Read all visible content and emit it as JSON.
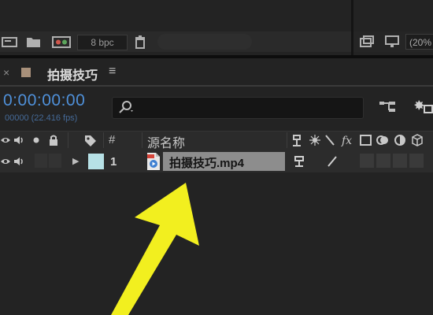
{
  "project_panel": {
    "bpc_label": "8 bpc",
    "zoom_value": "(20%"
  },
  "composition_tab": {
    "close_glyph": "×",
    "title": "拍摄技巧",
    "menu_glyph": "≡"
  },
  "timeline": {
    "timecode": "0:00:00:00",
    "frame_info": "00000 (22.416 fps)",
    "column_headers": {
      "number": "#",
      "source_name": "源名称"
    },
    "layer": {
      "index": "1",
      "name": "拍摄技巧.mp4",
      "label_color": "#b7e1e6"
    }
  },
  "annotation": {
    "arrow_color": "#f2ef1f"
  },
  "colors": {
    "timecode_blue": "#4f90d9",
    "panel_bg": "#232323"
  },
  "icons": [
    "comp-icon",
    "folder-icon",
    "color-settings-icon",
    "trash-icon",
    "snapshot-icon",
    "monitor-icon",
    "search-icon",
    "flowchart-icon",
    "render-icon",
    "eye-icon",
    "audio-icon",
    "solo-icon",
    "lock-icon",
    "label-icon",
    "file-icon",
    "shy-icon",
    "fx-icon"
  ]
}
